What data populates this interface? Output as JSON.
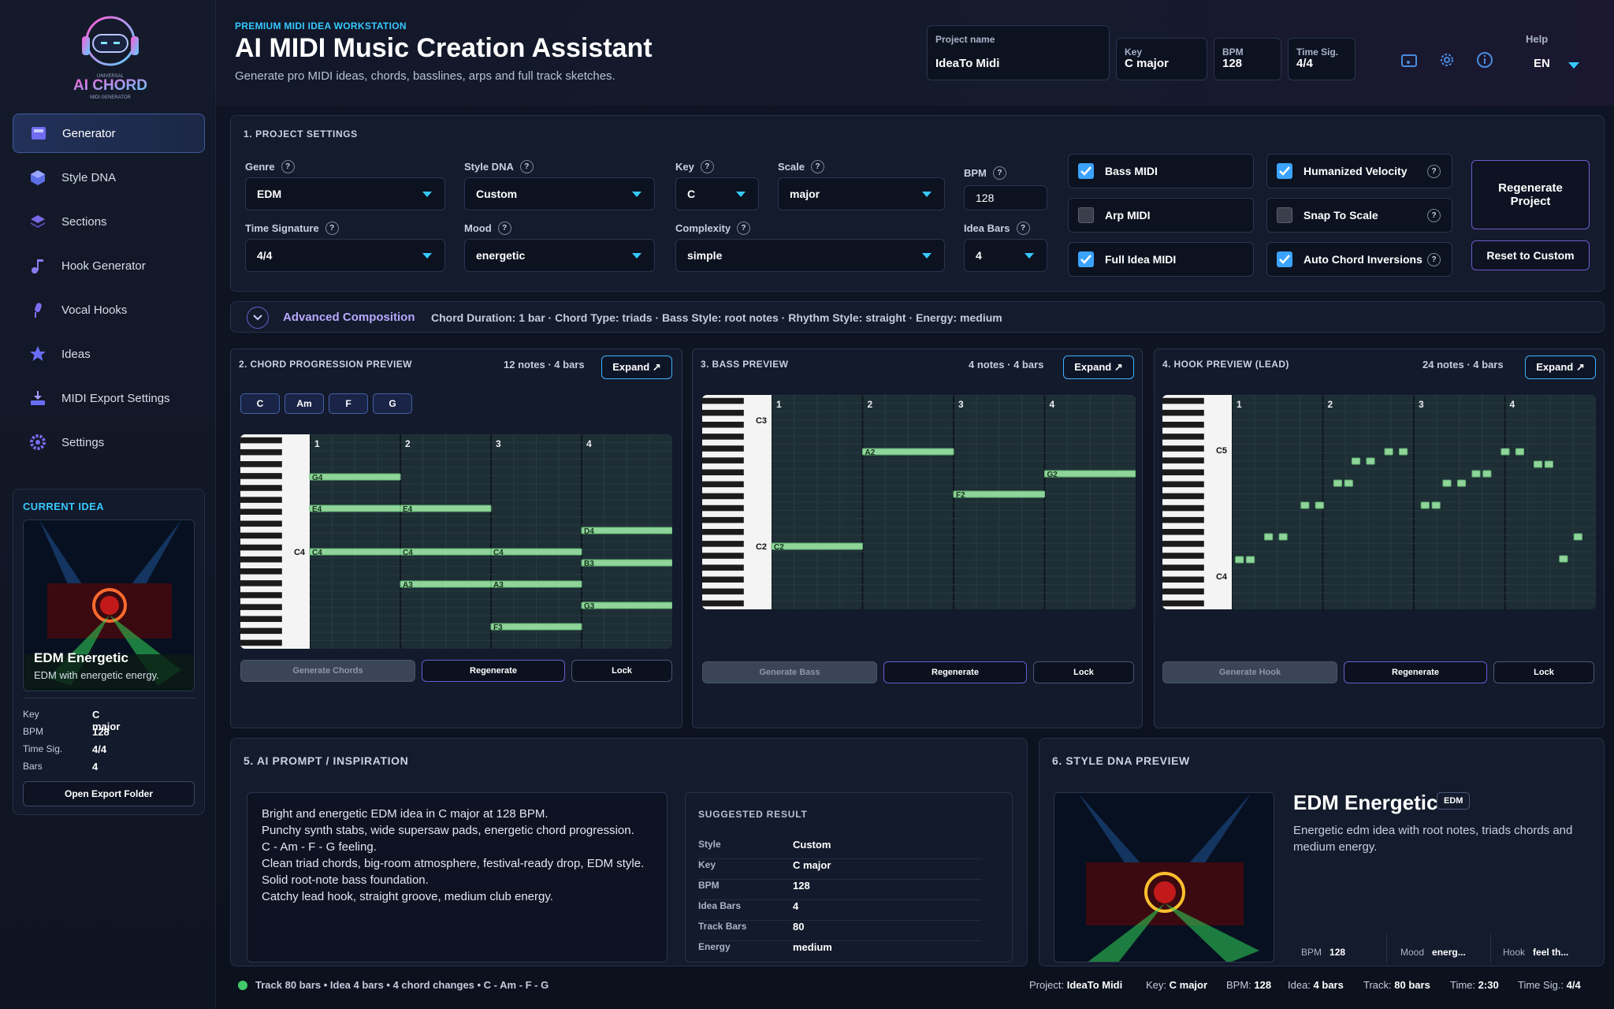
{
  "brand": {
    "logo_top": "UNIVERSAL",
    "logo_main": "AI CHORD",
    "logo_bottom": "MIDI GENERATOR"
  },
  "nav": [
    {
      "label": "Generator",
      "icon": "generator-icon"
    },
    {
      "label": "Style DNA",
      "icon": "cube-icon"
    },
    {
      "label": "Sections",
      "icon": "layers-icon"
    },
    {
      "label": "Hook Generator",
      "icon": "music-note-icon"
    },
    {
      "label": "Vocal Hooks",
      "icon": "microphone-icon"
    },
    {
      "label": "Ideas",
      "icon": "star-icon"
    },
    {
      "label": "MIDI Export Settings",
      "icon": "export-icon"
    },
    {
      "label": "Settings",
      "icon": "gear-icon"
    }
  ],
  "current_idea": {
    "heading": "CURRENT IDEA",
    "title": "EDM Energetic",
    "desc": "EDM with energetic energy.",
    "rows": [
      {
        "k": "Key",
        "v": "C major"
      },
      {
        "k": "BPM",
        "v": "128"
      },
      {
        "k": "Time Sig.",
        "v": "4/4"
      },
      {
        "k": "Bars",
        "v": "4"
      }
    ],
    "button": "Open Export Folder"
  },
  "header": {
    "sub": "PREMIUM MIDI IDEA WORKSTATION",
    "title": "AI MIDI Music Creation Assistant",
    "tagline": "Generate pro MIDI ideas, chords, basslines, arps and full track sketches.",
    "project_label": "Project name",
    "project_value": "IdeaTo Midi",
    "key_label": "Key",
    "key_value": "C major",
    "bpm_label": "BPM",
    "bpm_value": "128",
    "ts_label": "Time Sig.",
    "ts_value": "4/4",
    "help": "Help",
    "lang": "EN"
  },
  "settings": {
    "heading": "1. PROJECT SETTINGS",
    "genre_label": "Genre",
    "genre": "EDM",
    "style_label": "Style DNA",
    "style": "Custom",
    "key_label": "Key",
    "key": "C",
    "scale_label": "Scale",
    "scale": "major",
    "bpm_label": "BPM",
    "bpm": "128",
    "ts_label": "Time Signature",
    "ts": "4/4",
    "mood_label": "Mood",
    "mood": "energetic",
    "complexity_label": "Complexity",
    "complexity": "simple",
    "bars_label": "Idea Bars",
    "bars": "4",
    "checks": [
      {
        "label": "Bass MIDI",
        "on": true
      },
      {
        "label": "Arp MIDI",
        "on": false
      },
      {
        "label": "Full Idea MIDI",
        "on": true
      },
      {
        "label": "Humanized Velocity",
        "on": true
      },
      {
        "label": "Snap To Scale",
        "on": false
      },
      {
        "label": "Auto Chord Inversions",
        "on": true
      }
    ],
    "regenerate": "Regenerate Project",
    "reset": "Reset to Custom"
  },
  "advanced": {
    "label": "Advanced Composition",
    "summary": "Chord Duration: 1 bar · Chord Type: triads · Bass Style: root notes · Rhythm Style: straight · Energy: medium"
  },
  "chords": {
    "heading": "2. CHORD PROGRESSION PREVIEW",
    "meta": "12 notes · 4 bars",
    "expand": "Expand ↗",
    "chips": [
      "C",
      "Am",
      "F",
      "G"
    ],
    "gen": "Generate Chords",
    "regen": "Regenerate",
    "lock": "Lock",
    "c_label": "C4",
    "bars": [
      "1",
      "2",
      "3",
      "4"
    ]
  },
  "bass": {
    "heading": "3. BASS PREVIEW",
    "meta": "4 notes · 4 bars",
    "expand": "Expand ↗",
    "gen": "Generate Bass",
    "regen": "Regenerate",
    "lock": "Lock",
    "labels": [
      "C3",
      "C2"
    ],
    "bars": [
      "1",
      "2",
      "3",
      "4"
    ]
  },
  "hook": {
    "heading": "4. HOOK PREVIEW (LEAD)",
    "meta": "24 notes · 4 bars",
    "expand": "Expand ↗",
    "gen": "Generate Hook",
    "regen": "Regenerate",
    "lock": "Lock",
    "labels": [
      "C5",
      "C4"
    ],
    "bars": [
      "1",
      "2",
      "3",
      "4"
    ]
  },
  "prompt": {
    "heading": "5. AI PROMPT / INSPIRATION",
    "lines": [
      "Bright and energetic EDM idea in C major at 128 BPM.",
      "Punchy synth stabs, wide supersaw pads, energetic chord progression.",
      "C - Am - F - G feeling.",
      "Clean triad chords, big-room atmosphere, festival-ready drop, EDM style.",
      "Solid root-note bass foundation.",
      "Catchy lead hook, straight groove, medium club energy."
    ],
    "suggested_heading": "SUGGESTED RESULT",
    "suggested": [
      {
        "k": "Style",
        "v": "Custom"
      },
      {
        "k": "Key",
        "v": "C major"
      },
      {
        "k": "BPM",
        "v": "128"
      },
      {
        "k": "Idea Bars",
        "v": "4"
      },
      {
        "k": "Track Bars",
        "v": "80"
      },
      {
        "k": "Energy",
        "v": "medium"
      }
    ]
  },
  "dna": {
    "heading": "6. STYLE DNA PREVIEW",
    "title": "EDM Energetic",
    "badge": "EDM",
    "desc": "Energetic edm idea with root notes, triads chords and medium energy.",
    "bpm_label": "BPM",
    "bpm": "128",
    "mood_label": "Mood",
    "mood": "energ...",
    "hook_label": "Hook",
    "hook": "feel th..."
  },
  "status": {
    "left": "Track 80 bars • Idea 4 bars • 4 chord changes • C - Am - F - G",
    "project_k": "Project:",
    "project": "IdeaTo Midi",
    "key_k": "Key:",
    "key": "C major",
    "bpm_k": "BPM:",
    "bpm": "128",
    "idea_k": "Idea:",
    "idea": "4 bars",
    "track_k": "Track:",
    "track": "80 bars",
    "time_k": "Time:",
    "time": "2:30",
    "ts_k": "Time Sig.:",
    "ts": "4/4"
  },
  "colors": {
    "accent": "#37c9ff",
    "note": "#8fd59a",
    "purple": "#6d5bd0"
  }
}
